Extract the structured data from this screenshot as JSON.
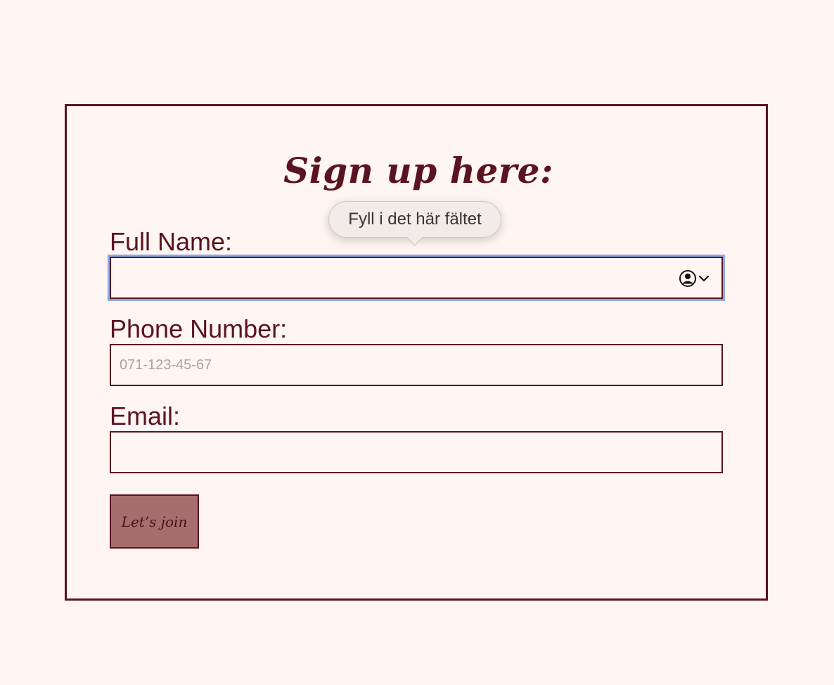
{
  "form": {
    "title": "Sign up here:",
    "fields": [
      {
        "label": "Full Name:",
        "value": "",
        "placeholder": ""
      },
      {
        "label": "Phone Number:",
        "value": "",
        "placeholder": "071-123-45-67"
      },
      {
        "label": "Email:",
        "value": "",
        "placeholder": ""
      }
    ],
    "submit_label": "Let’s join"
  },
  "tooltip": {
    "text": "Fyll i det här fältet"
  },
  "icons": {
    "autofill": "contact-card-icon",
    "autofill_menu": "chevron-down-icon"
  },
  "colors": {
    "background": "#fff5f2",
    "accent": "#5a1420",
    "button": "#a66e6e",
    "focus_ring": "#8aa8e6",
    "placeholder": "#a9a4a3"
  }
}
